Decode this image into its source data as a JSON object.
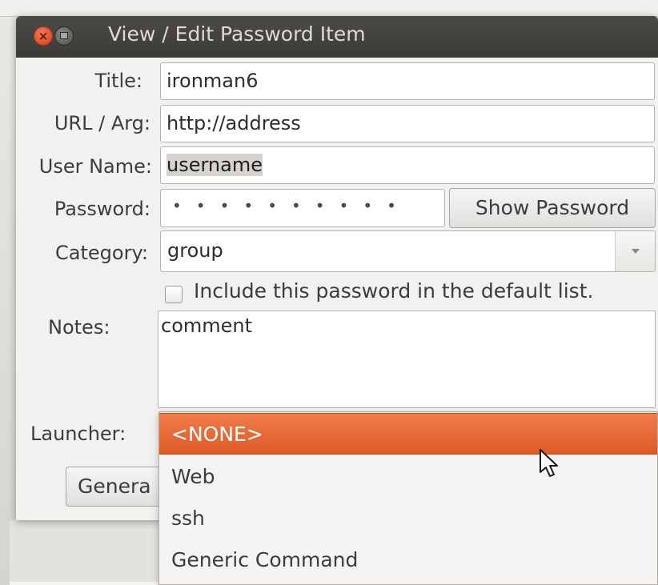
{
  "window": {
    "title": "View / Edit Password Item"
  },
  "form": {
    "title_label": "Title:",
    "title_value": "ironman6",
    "url_label": "URL / Arg:",
    "url_value": "http://address",
    "username_label": "User Name:",
    "username_value": "username",
    "password_label": "Password:",
    "password_dots": "••••••••••",
    "show_password_button": "Show Password",
    "category_label": "Category:",
    "category_value": "group",
    "include_default_label": "Include this password in the default list.",
    "include_default_checked": false,
    "notes_label": "Notes:",
    "notes_value": "comment",
    "launcher_label": "Launcher:",
    "generate_button": "Genera"
  },
  "launcher_dropdown": {
    "options": [
      "<NONE>",
      "Web",
      "ssh",
      "Generic Command"
    ],
    "highlighted": "<NONE>"
  },
  "colors": {
    "highlight": "#e8652f",
    "titlebar": "#3c3b37",
    "close_button": "#e04d2a"
  },
  "icons": {
    "close": "close-icon",
    "minimize": "minimize-icon",
    "dropdown_arrow": "chevron-down-icon",
    "cursor": "mouse-pointer-icon"
  }
}
